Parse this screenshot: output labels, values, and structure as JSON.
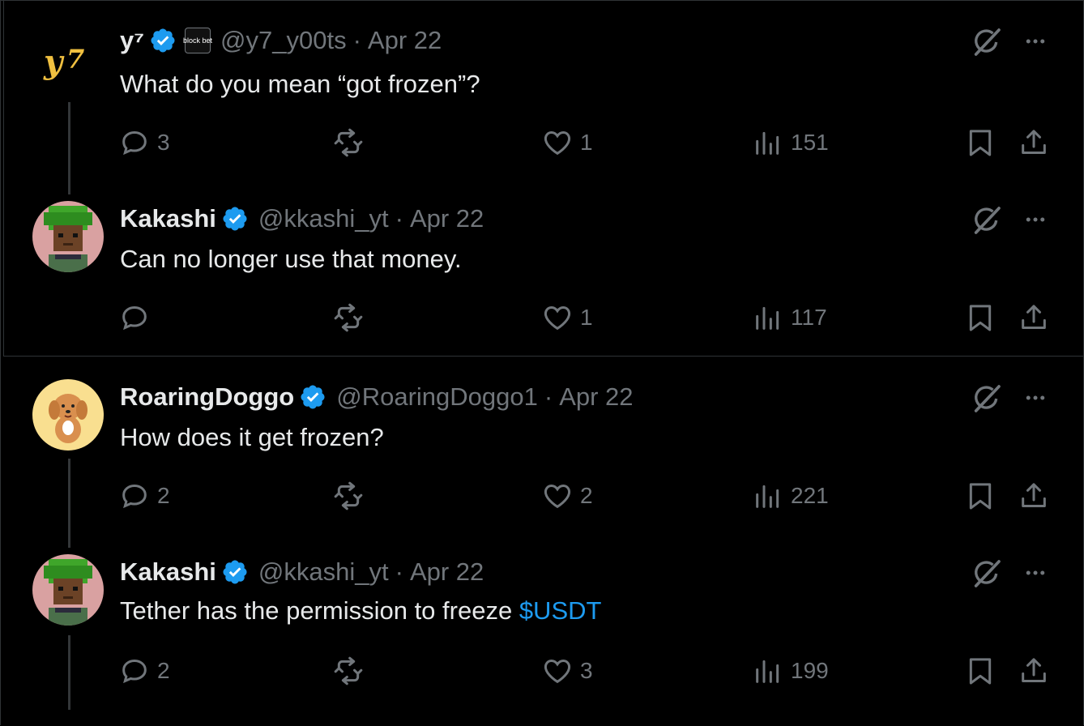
{
  "tweets": [
    {
      "name": "y⁷",
      "handle": "@y7_y00ts",
      "date": "Apr 22",
      "text": "What do you mean “got frozen”?",
      "affiliate": "block bet",
      "avatar": "y7-logo",
      "replies": "3",
      "reposts": "",
      "likes": "1",
      "views": "151"
    },
    {
      "name": "Kakashi",
      "handle": "@kkashi_yt",
      "date": "Apr 22",
      "text": "Can no longer use that money.",
      "avatar": "pixel-character-green-hair",
      "replies": "",
      "reposts": "",
      "likes": "1",
      "views": "117"
    },
    {
      "name": "RoaringDoggo",
      "handle": "@RoaringDoggo1",
      "date": "Apr 22",
      "text": "How does it get frozen?",
      "avatar": "cartoon-dog",
      "replies": "2",
      "reposts": "",
      "likes": "2",
      "views": "221"
    },
    {
      "name": "Kakashi",
      "handle": "@kkashi_yt",
      "date": "Apr 22",
      "text": "Tether has the permission to freeze ",
      "cashtag": "$USDT",
      "avatar": "pixel-character-green-hair",
      "replies": "2",
      "reposts": "",
      "likes": "3",
      "views": "199"
    }
  ],
  "separator": "·",
  "colors": {
    "background": "#000000",
    "text": "#e7e9ea",
    "muted": "#71767b",
    "accent": "#1d9bf0",
    "border": "#2f3336"
  }
}
